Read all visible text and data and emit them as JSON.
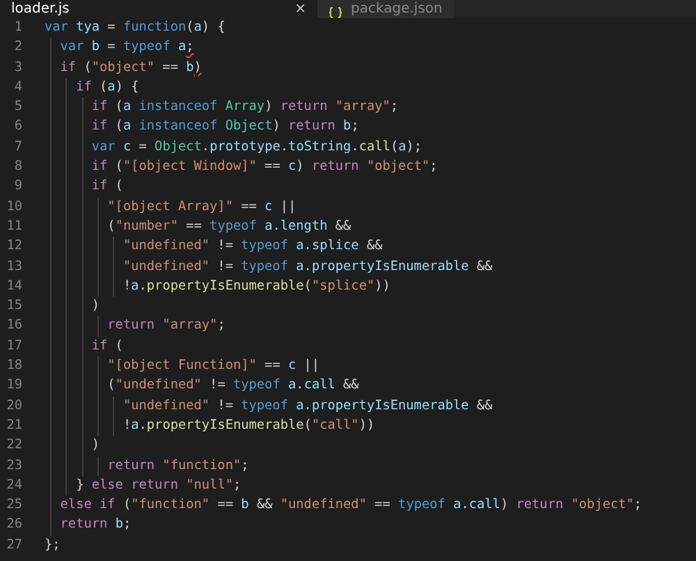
{
  "tabs": [
    {
      "label": "loader.js",
      "selected": true,
      "close": "×"
    },
    {
      "label": "package.json",
      "selected": false
    }
  ],
  "editor": {
    "lines": [
      {
        "number": "1",
        "tokens": [
          {
            "kind": "keyword",
            "text": "var "
          },
          {
            "kind": "variable",
            "text": "tya"
          },
          {
            "kind": "plain",
            "text": " = "
          },
          {
            "kind": "keyword",
            "text": "function"
          },
          {
            "kind": "plain",
            "text": "("
          },
          {
            "kind": "variable",
            "text": "a"
          },
          {
            "kind": "plain",
            "text": ") {"
          }
        ]
      },
      {
        "number": "2",
        "tokens": [
          {
            "kind": "keyword",
            "text": "  var "
          },
          {
            "kind": "variable",
            "text": "b"
          },
          {
            "kind": "plain",
            "text": " = "
          },
          {
            "kind": "keyword",
            "text": "typeof "
          },
          {
            "kind": "variable",
            "text": "a"
          },
          {
            "kind": "error",
            "text": ";"
          }
        ]
      },
      {
        "number": "3",
        "tokens": [
          {
            "kind": "control",
            "text": "  if"
          },
          {
            "kind": "plain",
            "text": " ("
          },
          {
            "kind": "string",
            "text": "\"object\""
          },
          {
            "kind": "plain",
            "text": " == "
          },
          {
            "kind": "variable",
            "text": "b"
          },
          {
            "kind": "error",
            "text": ")"
          }
        ]
      },
      {
        "number": "4",
        "tokens": [
          {
            "kind": "control",
            "text": "    if"
          },
          {
            "kind": "plain",
            "text": " ("
          },
          {
            "kind": "variable",
            "text": "a"
          },
          {
            "kind": "plain",
            "text": ") {"
          }
        ]
      },
      {
        "number": "5",
        "tokens": [
          {
            "kind": "control",
            "text": "      if"
          },
          {
            "kind": "plain",
            "text": " ("
          },
          {
            "kind": "variable",
            "text": "a "
          },
          {
            "kind": "keyword",
            "text": "instanceof "
          },
          {
            "kind": "type",
            "text": "Array"
          },
          {
            "kind": "plain",
            "text": ") "
          },
          {
            "kind": "control",
            "text": "return "
          },
          {
            "kind": "string",
            "text": "\"array\""
          },
          {
            "kind": "plain",
            "text": ";"
          }
        ]
      },
      {
        "number": "6",
        "tokens": [
          {
            "kind": "control",
            "text": "      if"
          },
          {
            "kind": "plain",
            "text": " ("
          },
          {
            "kind": "variable",
            "text": "a "
          },
          {
            "kind": "keyword",
            "text": "instanceof "
          },
          {
            "kind": "type",
            "text": "Object"
          },
          {
            "kind": "plain",
            "text": ") "
          },
          {
            "kind": "control",
            "text": "return "
          },
          {
            "kind": "variable",
            "text": "b"
          },
          {
            "kind": "plain",
            "text": ";"
          }
        ]
      },
      {
        "number": "7",
        "tokens": [
          {
            "kind": "keyword",
            "text": "      var "
          },
          {
            "kind": "variable",
            "text": "c"
          },
          {
            "kind": "plain",
            "text": " = "
          },
          {
            "kind": "type",
            "text": "Object"
          },
          {
            "kind": "plain",
            "text": "."
          },
          {
            "kind": "variable",
            "text": "prototype"
          },
          {
            "kind": "plain",
            "text": "."
          },
          {
            "kind": "variable",
            "text": "toString"
          },
          {
            "kind": "plain",
            "text": "."
          },
          {
            "kind": "method",
            "text": "call"
          },
          {
            "kind": "plain",
            "text": "("
          },
          {
            "kind": "variable",
            "text": "a"
          },
          {
            "kind": "plain",
            "text": ");"
          }
        ]
      },
      {
        "number": "8",
        "tokens": [
          {
            "kind": "control",
            "text": "      if"
          },
          {
            "kind": "plain",
            "text": " ("
          },
          {
            "kind": "string",
            "text": "\"[object Window]\""
          },
          {
            "kind": "plain",
            "text": " == "
          },
          {
            "kind": "variable",
            "text": "c"
          },
          {
            "kind": "plain",
            "text": ") "
          },
          {
            "kind": "control",
            "text": "return "
          },
          {
            "kind": "string",
            "text": "\"object\""
          },
          {
            "kind": "plain",
            "text": ";"
          }
        ]
      },
      {
        "number": "9",
        "tokens": [
          {
            "kind": "control",
            "text": "      if"
          },
          {
            "kind": "plain",
            "text": " ("
          }
        ]
      },
      {
        "number": "10",
        "tokens": [
          {
            "kind": "string",
            "text": "        \"[object Array]\""
          },
          {
            "kind": "plain",
            "text": " == "
          },
          {
            "kind": "variable",
            "text": "c"
          },
          {
            "kind": "plain",
            "text": " ||"
          }
        ]
      },
      {
        "number": "11",
        "tokens": [
          {
            "kind": "plain",
            "text": "        ("
          },
          {
            "kind": "string",
            "text": "\"number\""
          },
          {
            "kind": "plain",
            "text": " == "
          },
          {
            "kind": "keyword",
            "text": "typeof "
          },
          {
            "kind": "variable",
            "text": "a"
          },
          {
            "kind": "plain",
            "text": "."
          },
          {
            "kind": "variable",
            "text": "length"
          },
          {
            "kind": "plain",
            "text": " &&"
          }
        ]
      },
      {
        "number": "12",
        "tokens": [
          {
            "kind": "string",
            "text": "          \"undefined\""
          },
          {
            "kind": "plain",
            "text": " != "
          },
          {
            "kind": "keyword",
            "text": "typeof "
          },
          {
            "kind": "variable",
            "text": "a"
          },
          {
            "kind": "plain",
            "text": "."
          },
          {
            "kind": "variable",
            "text": "splice"
          },
          {
            "kind": "plain",
            "text": " &&"
          }
        ]
      },
      {
        "number": "13",
        "tokens": [
          {
            "kind": "string",
            "text": "          \"undefined\""
          },
          {
            "kind": "plain",
            "text": " != "
          },
          {
            "kind": "keyword",
            "text": "typeof "
          },
          {
            "kind": "variable",
            "text": "a"
          },
          {
            "kind": "plain",
            "text": "."
          },
          {
            "kind": "variable",
            "text": "propertyIsEnumerable"
          },
          {
            "kind": "plain",
            "text": " &&"
          }
        ]
      },
      {
        "number": "14",
        "tokens": [
          {
            "kind": "plain",
            "text": "          !"
          },
          {
            "kind": "variable",
            "text": "a"
          },
          {
            "kind": "plain",
            "text": "."
          },
          {
            "kind": "method",
            "text": "propertyIsEnumerable"
          },
          {
            "kind": "plain",
            "text": "("
          },
          {
            "kind": "string",
            "text": "\"splice\""
          },
          {
            "kind": "plain",
            "text": "))"
          }
        ]
      },
      {
        "number": "15",
        "tokens": [
          {
            "kind": "plain",
            "text": "      )"
          }
        ]
      },
      {
        "number": "16",
        "tokens": [
          {
            "kind": "control",
            "text": "        return "
          },
          {
            "kind": "string",
            "text": "\"array\""
          },
          {
            "kind": "plain",
            "text": ";"
          }
        ]
      },
      {
        "number": "17",
        "tokens": [
          {
            "kind": "control",
            "text": "      if"
          },
          {
            "kind": "plain",
            "text": " ("
          }
        ]
      },
      {
        "number": "18",
        "tokens": [
          {
            "kind": "string",
            "text": "        \"[object Function]\""
          },
          {
            "kind": "plain",
            "text": " == "
          },
          {
            "kind": "variable",
            "text": "c"
          },
          {
            "kind": "plain",
            "text": " ||"
          }
        ]
      },
      {
        "number": "19",
        "tokens": [
          {
            "kind": "plain",
            "text": "        ("
          },
          {
            "kind": "string",
            "text": "\"undefined\""
          },
          {
            "kind": "plain",
            "text": " != "
          },
          {
            "kind": "keyword",
            "text": "typeof "
          },
          {
            "kind": "variable",
            "text": "a"
          },
          {
            "kind": "plain",
            "text": "."
          },
          {
            "kind": "variable",
            "text": "call"
          },
          {
            "kind": "plain",
            "text": " &&"
          }
        ]
      },
      {
        "number": "20",
        "tokens": [
          {
            "kind": "string",
            "text": "          \"undefined\""
          },
          {
            "kind": "plain",
            "text": " != "
          },
          {
            "kind": "keyword",
            "text": "typeof "
          },
          {
            "kind": "variable",
            "text": "a"
          },
          {
            "kind": "plain",
            "text": "."
          },
          {
            "kind": "variable",
            "text": "propertyIsEnumerable"
          },
          {
            "kind": "plain",
            "text": " &&"
          }
        ]
      },
      {
        "number": "21",
        "tokens": [
          {
            "kind": "plain",
            "text": "          !"
          },
          {
            "kind": "variable",
            "text": "a"
          },
          {
            "kind": "plain",
            "text": "."
          },
          {
            "kind": "method",
            "text": "propertyIsEnumerable"
          },
          {
            "kind": "plain",
            "text": "("
          },
          {
            "kind": "string",
            "text": "\"call\""
          },
          {
            "kind": "plain",
            "text": "))"
          }
        ]
      },
      {
        "number": "22",
        "tokens": [
          {
            "kind": "plain",
            "text": "      )"
          }
        ]
      },
      {
        "number": "23",
        "tokens": [
          {
            "kind": "control",
            "text": "        return "
          },
          {
            "kind": "string",
            "text": "\"function\""
          },
          {
            "kind": "plain",
            "text": ";"
          }
        ]
      },
      {
        "number": "24",
        "tokens": [
          {
            "kind": "plain",
            "text": "    } "
          },
          {
            "kind": "control",
            "text": "else "
          },
          {
            "kind": "control",
            "text": "return "
          },
          {
            "kind": "string",
            "text": "\"null\""
          },
          {
            "kind": "plain",
            "text": ";"
          }
        ]
      },
      {
        "number": "25",
        "tokens": [
          {
            "kind": "control",
            "text": "  else "
          },
          {
            "kind": "control",
            "text": "if"
          },
          {
            "kind": "plain",
            "text": " ("
          },
          {
            "kind": "string",
            "text": "\"function\""
          },
          {
            "kind": "plain",
            "text": " == "
          },
          {
            "kind": "variable",
            "text": "b"
          },
          {
            "kind": "plain",
            "text": " && "
          },
          {
            "kind": "string",
            "text": "\"undefined\""
          },
          {
            "kind": "plain",
            "text": " == "
          },
          {
            "kind": "keyword",
            "text": "typeof "
          },
          {
            "kind": "variable",
            "text": "a"
          },
          {
            "kind": "plain",
            "text": "."
          },
          {
            "kind": "variable",
            "text": "call"
          },
          {
            "kind": "plain",
            "text": ") "
          },
          {
            "kind": "control",
            "text": "return "
          },
          {
            "kind": "string",
            "text": "\"object\""
          },
          {
            "kind": "plain",
            "text": ";"
          }
        ]
      },
      {
        "number": "26",
        "tokens": [
          {
            "kind": "control",
            "text": "  return "
          },
          {
            "kind": "variable",
            "text": "b"
          },
          {
            "kind": "plain",
            "text": ";"
          }
        ]
      },
      {
        "number": "27",
        "tokens": [
          {
            "kind": "plain",
            "text": "};"
          }
        ]
      }
    ]
  }
}
